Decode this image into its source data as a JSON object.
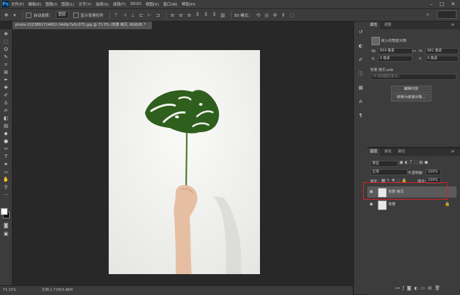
{
  "menu": {
    "logo": "Ps",
    "items": [
      "文件(F)",
      "编辑(E)",
      "图像(I)",
      "图层(L)",
      "文字(Y)",
      "选择(S)",
      "滤镜(T)",
      "3D(D)",
      "视图(V)",
      "窗口(W)",
      "帮助(H)"
    ]
  },
  "options": {
    "auto_select_label": "自动选择：",
    "auto_select_value": "图层",
    "show_transform_label": "显示变换控件",
    "mode_3d_label": "3D 模式："
  },
  "document": {
    "tab_title": "photo-1523891724652-34d9c7e5c075.jpg @ 73.3% (背景 拷贝, RGB/8) *",
    "zoom": "73.33%",
    "doc_info": "文档:1.71M/3.45M"
  },
  "properties_panel": {
    "tabs": [
      "属性",
      "调整"
    ],
    "type_label": "嵌入的智能对象",
    "w_label": "W:",
    "w_value": "654 像素",
    "h_label": "H:",
    "h_value": "981 像素",
    "x_label": "X:",
    "x_value": "0 像素",
    "y_label": "Y:",
    "y_value": "0 像素",
    "file_name": "背景 拷贝.psb",
    "comp_placeholder": "(不适用图层复合)",
    "edit_button": "编辑内容",
    "convert_button": "转换为链接对象..."
  },
  "layers_panel": {
    "tabs": [
      "图层",
      "通道",
      "路径"
    ],
    "filter_kind": "类型",
    "blend_mode": "正常",
    "opacity_label": "不透明度:",
    "opacity_value": "100%",
    "lock_label": "锁定:",
    "fill_label": "填充:",
    "fill_value": "100%",
    "layers": [
      {
        "name": "背景 拷贝",
        "selected": true
      },
      {
        "name": "背景",
        "selected": false
      }
    ]
  },
  "colors": {
    "highlight": "#d9202a",
    "accent": "#31a8ff"
  }
}
